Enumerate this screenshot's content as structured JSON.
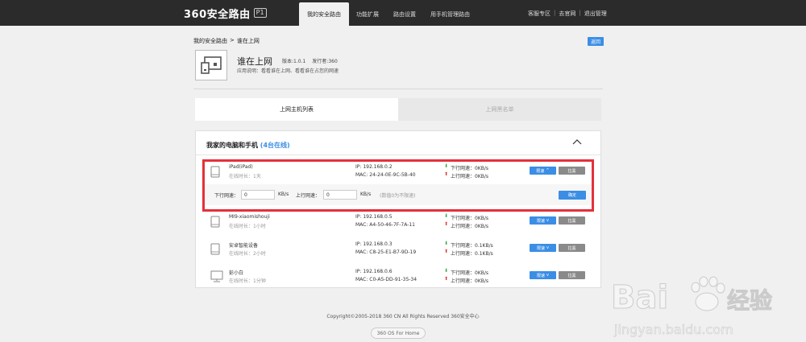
{
  "header": {
    "logo_text": "360安全路由",
    "logo_badge": "P1",
    "nav": [
      {
        "label": "我的安全路由",
        "active": true
      },
      {
        "label": "功能扩展"
      },
      {
        "label": "路由设置"
      },
      {
        "label": "用手机管理路由"
      }
    ],
    "links": {
      "vip": "客服专区",
      "sep": "|",
      "go": "去官网",
      "logout": "退出管理"
    }
  },
  "breadcrumb": {
    "root": "我的安全路由",
    "sep": ">",
    "current": "谁在上网"
  },
  "back_label": "返回",
  "app": {
    "title": "谁在上网",
    "version": "版本:1.0.1",
    "publisher": "发行者:360",
    "desc": "应用说明：看看谁在上网、看看谁在占您的网速"
  },
  "tabs": [
    {
      "label": "上网主机列表",
      "active": true
    },
    {
      "label": "上网黑名单"
    }
  ],
  "panel": {
    "title": "我家的电脑和手机",
    "online": "(4台在线)"
  },
  "devices": [
    {
      "name": "iPad(iPad)",
      "time": "在线时长：1天",
      "ip": "IP: 192.168.0.2",
      "mac": "MAC: 24-24-0E-9C-5B-40",
      "down": "下行网速：0KB/s",
      "up": "上行网速：0KB/s",
      "type": "tablet"
    },
    {
      "name": "MI9-xiaomishouji",
      "time": "在线时长：1小时",
      "ip": "IP: 192.168.0.5",
      "mac": "MAC: A4-50-46-7F-7A-11",
      "down": "下行网速：0KB/s",
      "up": "上行网速：0KB/s",
      "type": "tablet"
    },
    {
      "name": "安卓智能设备",
      "time": "在线时长：2小时",
      "ip": "IP: 192.168.0.3",
      "mac": "MAC: C8-25-E1-B7-9D-19",
      "down": "下行网速：0.1KB/s",
      "up": "上行网速：0.1KB/s",
      "type": "tablet"
    },
    {
      "name": "彭小白",
      "time": "在线时长：1分钟",
      "ip": "IP: 192.168.0.6",
      "mac": "MAC: C0-A5-DD-91-35-34",
      "down": "下行网速：0KB/s",
      "up": "上行网速：0KB/s",
      "type": "monitor"
    }
  ],
  "buttons": {
    "limit": "限速",
    "block": "拉黑",
    "confirm": "确定"
  },
  "limit_form": {
    "down_label": "下行网速：",
    "down_value": "0",
    "down_unit": "KB/s",
    "up_label": "上行网速：",
    "up_value": "0",
    "up_unit": "KB/s",
    "note": "(数值0为不限速)"
  },
  "footer": {
    "copyright": "Copyright©2005-2018 360 CN All Rights Reserved 360安全中心",
    "badge": "360 OS For Home"
  },
  "watermark": {
    "brand": "Bai",
    "brand_cn": "经验",
    "url": "jingyan.baidu.com"
  },
  "colors": {
    "accent": "#3b8ee5",
    "highlight": "#e5303a",
    "topbar": "#2b2b2b"
  }
}
